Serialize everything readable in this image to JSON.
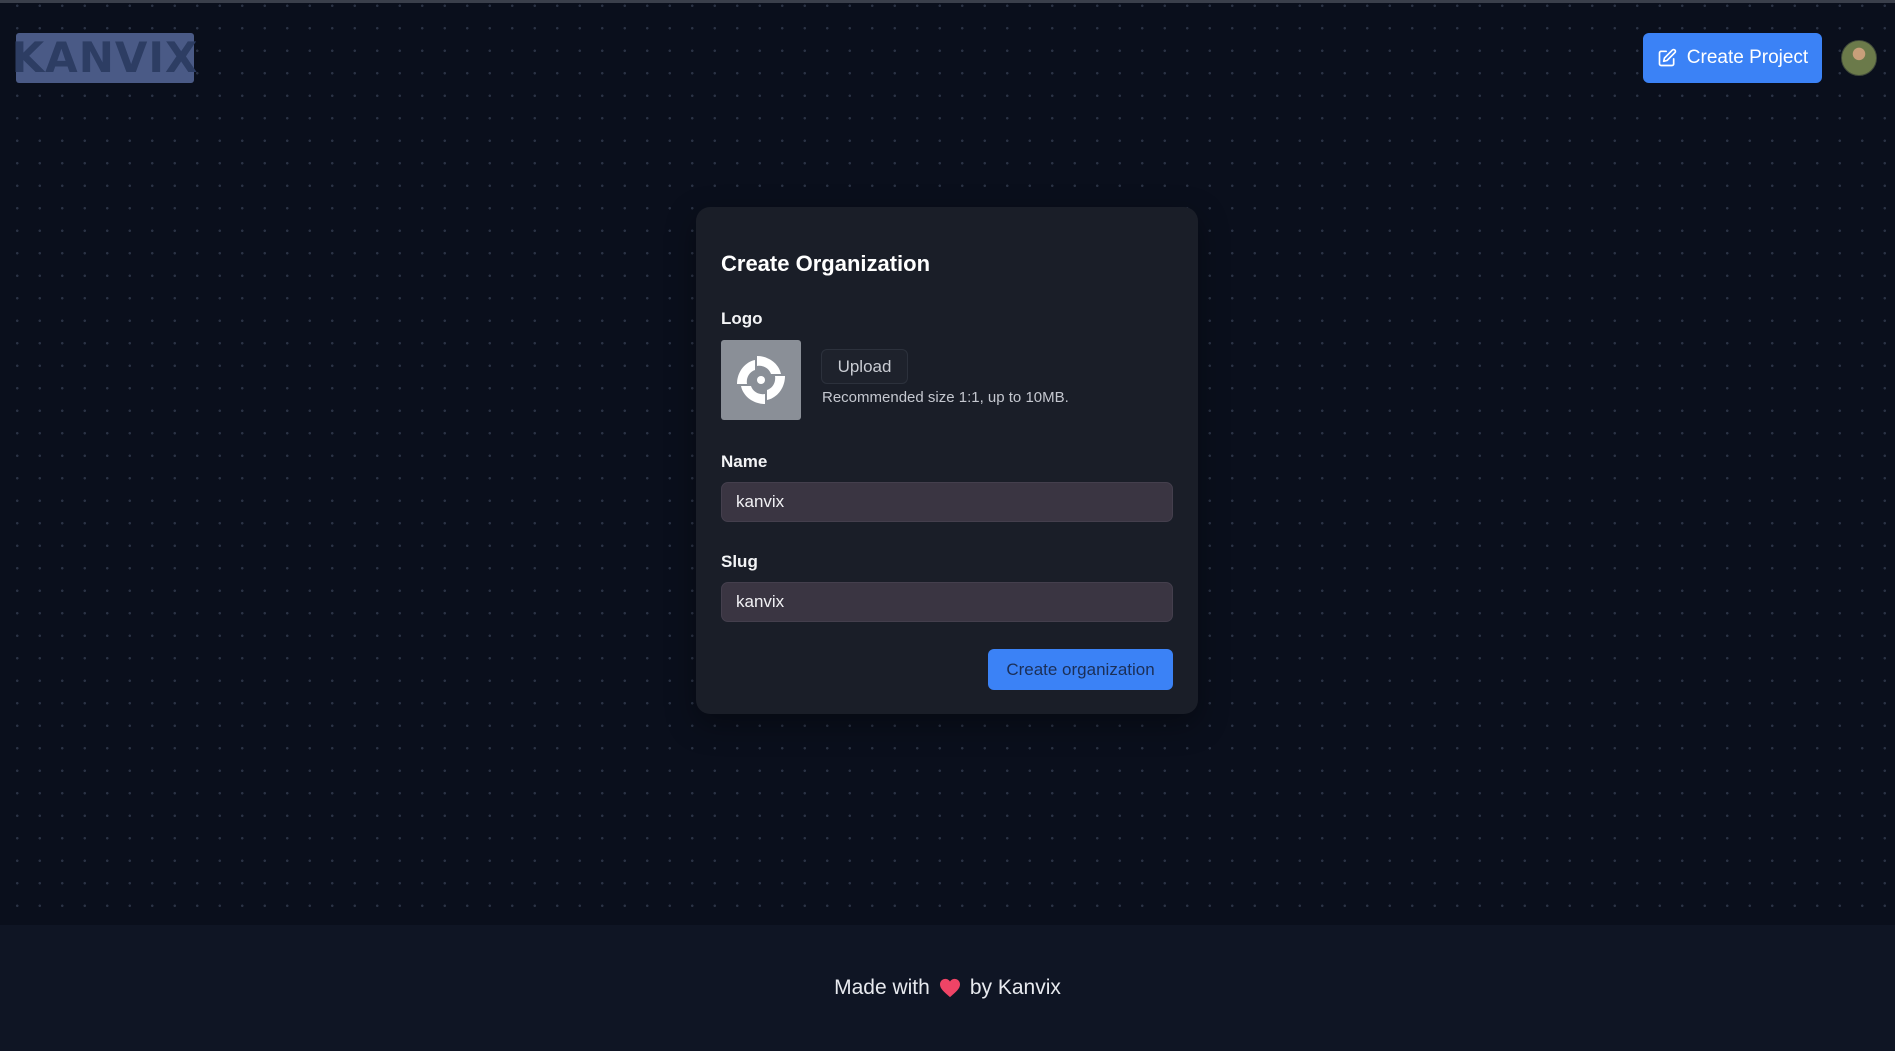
{
  "header": {
    "logo_text": "KANVIX",
    "create_project_label": "Create Project"
  },
  "form": {
    "title": "Create Organization",
    "logo_label": "Logo",
    "upload_label": "Upload",
    "upload_hint": "Recommended size 1:1, up to 10MB.",
    "name_label": "Name",
    "name_value": "kanvix",
    "slug_label": "Slug",
    "slug_value": "kanvix",
    "submit_label": "Create organization"
  },
  "footer": {
    "made_with": "Made with",
    "by_text": "by Kanvix"
  },
  "colors": {
    "accent": "#3b82f6",
    "background": "#0a0f1c",
    "card": "#1a1e28",
    "heart": "#ef4466"
  },
  "icons": {
    "create_project": "edit-icon",
    "logo_preview": "org-logo-icon",
    "heart": "heart-icon"
  }
}
